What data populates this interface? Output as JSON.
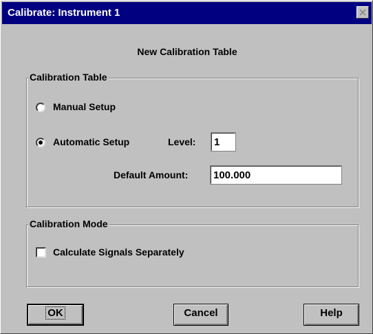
{
  "window": {
    "title": "Calibrate: Instrument 1",
    "title_bar_color": "#000080"
  },
  "heading": "New Calibration Table",
  "calibration_table": {
    "group_label": "Calibration Table",
    "manual_setup_label": "Manual Setup",
    "manual_setup_selected": false,
    "automatic_setup_label": "Automatic Setup",
    "automatic_setup_selected": true,
    "level_label": "Level:",
    "level_value": "1",
    "default_amount_label": "Default Amount:",
    "default_amount_value": "100.000"
  },
  "calibration_mode": {
    "group_label": "Calibration Mode",
    "calculate_signals_label": "Calculate Signals Separately",
    "calculate_signals_checked": false
  },
  "buttons": {
    "ok_label": "OK",
    "cancel_label": "Cancel",
    "help_label": "Help"
  },
  "icons": [
    "close-icon"
  ]
}
